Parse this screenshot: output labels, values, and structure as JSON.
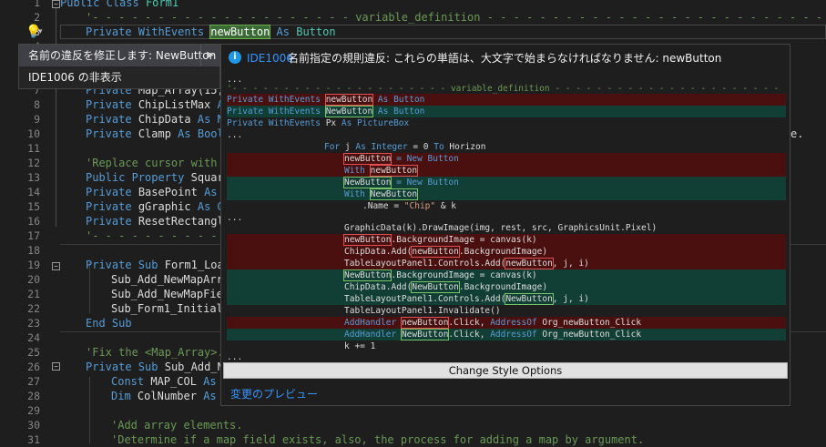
{
  "editor": {
    "line_numbers": [
      "1",
      "2",
      "3",
      "4",
      "5",
      "6",
      "7",
      "8",
      "9",
      "10",
      "11",
      "12",
      "13",
      "14",
      "15",
      "16",
      "17",
      "18",
      "19",
      "20",
      "21",
      "22",
      "23",
      "24",
      "25",
      "26",
      "27",
      "28",
      "29",
      "30",
      "31"
    ],
    "lines": {
      "l1": {
        "kw": "Public Class",
        "name": "Form1"
      },
      "l2": "'- - - - - - - - - - - - - - - - - - - - variable_definition - - - - - - - - - - - - - - - - - - - - - - - - - - -",
      "l3": {
        "kw1": "Private WithEvents",
        "name": "newButton",
        "kw2": "As",
        "type": "Button"
      },
      "l7": {
        "kw": "Private",
        "name": "Map_Array(15,"
      },
      "l8": {
        "kw": "Private",
        "name": "ChipListMax",
        "kw2": "A"
      },
      "l9": {
        "kw": "Private",
        "name": "ChipData",
        "kw2": "As N"
      },
      "l10": {
        "kw": "Private",
        "name": "Clamp",
        "kw2": "As Bool",
        "tail": "e."
      },
      "l12": "'Replace cursor with",
      "l13": {
        "kw": "Public Property",
        "name": "Squar"
      },
      "l14": {
        "kw": "Private",
        "name": "BasePoint",
        "kw2": "As"
      },
      "l15": {
        "kw": "Private",
        "name": "gGraphic",
        "kw2": "As G"
      },
      "l16": {
        "kw": "Private",
        "name": "ResetRectangl"
      },
      "l17": "'- - - - - - - - - - - - - - - - - - - - - - - - - - - - - - - - - - - - - - - - - - - - - - - - - - - - - - - - -",
      "l19": {
        "kw": "Private Sub",
        "name": "Form1_Loa"
      },
      "l20": "Sub_Add_NewMapArr",
      "l21": "Sub_Add_NewMapFie",
      "l22": "Sub_Form1_Initial",
      "l23": "End Sub",
      "l25": "'Fix the <Map_Array>.",
      "l26": {
        "kw": "Private Sub",
        "name": "Sub_Add_N"
      },
      "l27": {
        "kw": "Const",
        "name": "MAP_COL",
        "kw2": "As"
      },
      "l28": {
        "kw": "Dim",
        "name": "ColNumber",
        "kw2": "As"
      },
      "l30": "'Add array elements.",
      "l31": "'Determine if a map field exists, also, the process for adding a map by argument."
    }
  },
  "quick_actions": {
    "items": [
      {
        "label": "名前の違反を修正します: NewButton"
      },
      {
        "label": "IDE1006 の非表示"
      }
    ],
    "submenu_glyph": "▶"
  },
  "preview": {
    "info_glyph": "i",
    "diagnostic_id": "IDE1006",
    "message": "名前指定の規則違反: これらの単語は、大文字で始まらなければなりません: newButton",
    "ellipsis": "...",
    "region_comment": "'- - - - - - - - - - - - - - - - - - - - - variable_definition - - - - - - - - - - - - - - - - - - - - - -",
    "decl_del": {
      "kw": "Private WithEvents",
      "name": "newButton",
      "rest": "As Button"
    },
    "decl_add": {
      "kw": "Private WithEvents",
      "name": "NewButton",
      "rest": "As Button"
    },
    "decl_px": {
      "kw": "Private WithEvents",
      "name": "Px",
      "rest": "As PictureBox"
    },
    "for_line": {
      "kw1": "For",
      "var": "j",
      "kw2": "As Integer",
      "rest": "= 0",
      "kw3": "To",
      "end": "Horizon"
    },
    "new_del": {
      "name": "newButton",
      "rest": "= New Button"
    },
    "with_del": {
      "kw": "With",
      "name": "newButton"
    },
    "new_add": {
      "name": "NewButton",
      "rest": "= New Button"
    },
    "with_add": {
      "kw": "With",
      "name": "NewButton"
    },
    "name_line": {
      "prop": ".Name =",
      "str": "\"Chip\"",
      "rest": "& k"
    },
    "draw_line": "GraphicData(k).DrawImage(img, rest, src, GraphicsUnit.Pixel)",
    "bg_del": {
      "name": "newButton",
      "rest": ".BackgroundImage = canvas(k)"
    },
    "chip_del": {
      "pre": "ChipData.Add(",
      "name": "newButton",
      "post": ".BackgroundImage)"
    },
    "tlp_del": {
      "pre": "TableLayoutPanel1.Controls.Add(",
      "name": "newButton",
      "post": ", j, i)"
    },
    "bg_add": {
      "name": "NewButton",
      "rest": ".BackgroundImage = canvas(k)"
    },
    "chip_add": {
      "pre": "ChipData.Add(",
      "name": "NewButton",
      "post": ".BackgroundImage)"
    },
    "tlp_add": {
      "pre": "TableLayoutPanel1.Controls.Add(",
      "name": "NewButton",
      "post": ", j, i)"
    },
    "invalidate": "TableLayoutPanel1.Invalidate()",
    "handler_del": {
      "kw": "AddHandler",
      "name": "newButton",
      "mid": ".Click,",
      "kw2": "AddressOf",
      "target": "Org_newButton_Click"
    },
    "handler_add": {
      "kw": "AddHandler",
      "name": "NewButton",
      "mid": ".Click,",
      "kw2": "AddressOf",
      "target": "Org_newButton_Click"
    },
    "increment": "k += 1",
    "change_style_button": "Change Style Options",
    "preview_changes_link": "変更のプレビュー"
  },
  "colors": {
    "background": "#1e1e1e",
    "keyword": "#569cd6",
    "type": "#4ec9b0",
    "comment": "#6a9955",
    "deleted_row": "#4a0f0f",
    "added_row": "#123f35",
    "link": "#3794ff"
  },
  "icons": {
    "lightbulb": "lightbulb-icon",
    "info": "info-icon",
    "submenu": "chevron-right-icon",
    "fold": "fold-collapse-icon"
  }
}
